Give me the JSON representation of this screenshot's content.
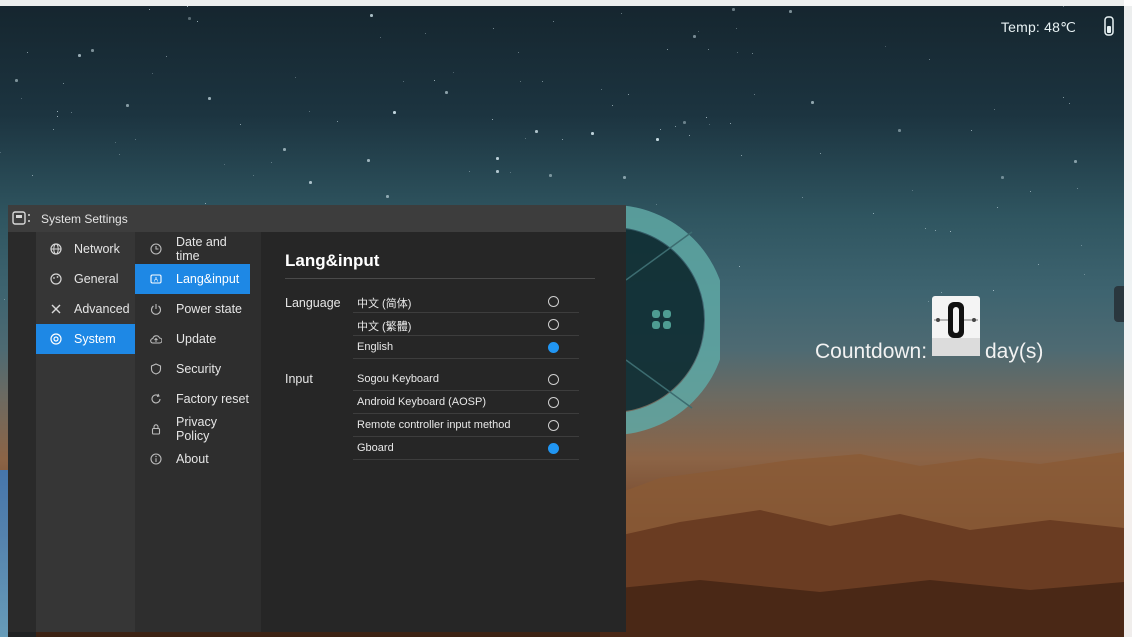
{
  "status": {
    "temperature": "Temp: 48℃",
    "icon": "thermometer-icon"
  },
  "countdown": {
    "label": "Countdown:",
    "value": "0",
    "unit": "day(s)"
  },
  "window": {
    "title": "System Settings"
  },
  "main_nav": [
    {
      "label": "Network",
      "icon": "globe-icon"
    },
    {
      "label": "General",
      "icon": "palette-icon"
    },
    {
      "label": "Advanced",
      "icon": "tools-icon"
    },
    {
      "label": "System",
      "icon": "system-icon",
      "active": true
    }
  ],
  "sub_nav": [
    {
      "label": "Date and time",
      "icon": "clock-icon"
    },
    {
      "label": "Lang&input",
      "icon": "keyboard-icon",
      "active": true
    },
    {
      "label": "Power state",
      "icon": "power-icon"
    },
    {
      "label": "Update",
      "icon": "cloud-upload-icon"
    },
    {
      "label": "Security",
      "icon": "shield-icon"
    },
    {
      "label": "Factory reset",
      "icon": "reset-icon"
    },
    {
      "label": "Privacy Policy",
      "icon": "lock-icon"
    },
    {
      "label": "About",
      "icon": "info-icon"
    }
  ],
  "panel": {
    "title": "Lang&input",
    "language": {
      "label": "Language",
      "options": [
        {
          "label": "中文 (简体)",
          "selected": false
        },
        {
          "label": "中文 (繁體)",
          "selected": false
        },
        {
          "label": "English",
          "selected": true
        }
      ]
    },
    "input": {
      "label": "Input",
      "options": [
        {
          "label": "Sogou Keyboard",
          "selected": false
        },
        {
          "label": "Android Keyboard (AOSP)",
          "selected": false
        },
        {
          "label": "Remote controller input method",
          "selected": false
        },
        {
          "label": "Gboard",
          "selected": true
        }
      ]
    }
  },
  "dock": [
    "back-icon",
    "home-icon",
    "settings-icon",
    "folder-icon",
    "screen-icon",
    "keyboard-icon",
    "power-icon"
  ],
  "colors": {
    "accent": "#1e88e5",
    "radio_checked": "#2196f3",
    "window_bg": "#2a2a2a",
    "titlebar_bg": "#3d3d3d"
  }
}
